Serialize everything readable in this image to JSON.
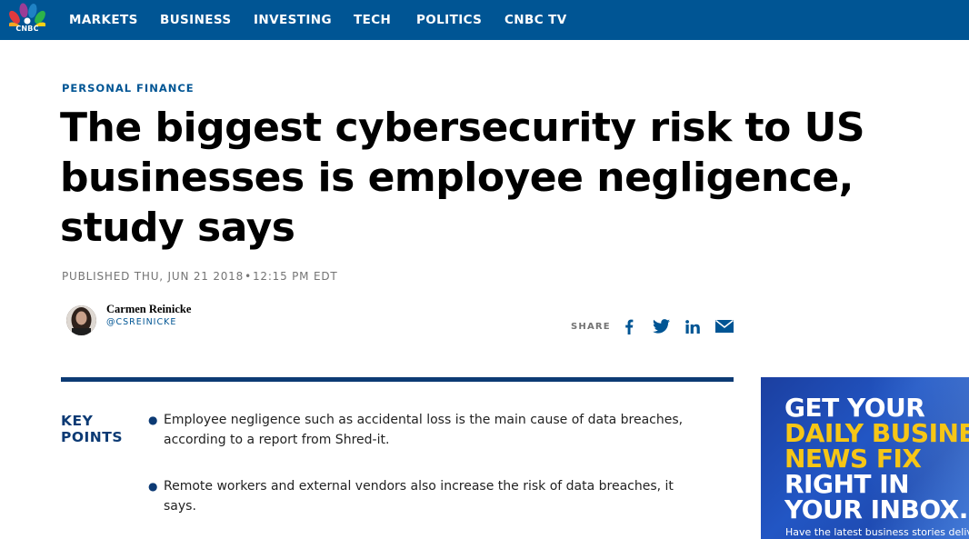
{
  "nav": {
    "logo_text": "CNBC",
    "items": [
      "MARKETS",
      "BUSINESS",
      "INVESTING",
      "TECH",
      "POLITICS",
      "CNBC TV"
    ]
  },
  "article": {
    "section": "PERSONAL FINANCE",
    "headline": "The biggest cybersecurity risk to US businesses is employee negligence, study says",
    "published_prefix": "PUBLISHED THU, JUN 21 2018",
    "published_dot": "•",
    "published_time": "12:15 PM EDT",
    "author": {
      "name": "Carmen Reinicke",
      "handle": "@CSREINICKE"
    },
    "share_label": "SHARE",
    "share_icons": [
      "facebook-icon",
      "twitter-icon",
      "linkedin-icon",
      "email-icon"
    ],
    "key_points": {
      "title_line1": "KEY",
      "title_line2": "POINTS",
      "items": [
        "Employee negligence such as accidental loss is the main cause of data breaches, according to a report from Shred-it.",
        "Remote workers and external vendors also increase the risk of data breaches, it says."
      ]
    }
  },
  "ad": {
    "lines": [
      "GET YOUR",
      "DAILY BUSINESS",
      "NEWS FIX",
      "RIGHT IN",
      "YOUR INBOX."
    ],
    "subtext": "Have the latest business stories delivered"
  },
  "colors": {
    "nav_bg": "#005594",
    "accent_blue": "#0c3a74",
    "ad_yellow": "#f6c616"
  }
}
